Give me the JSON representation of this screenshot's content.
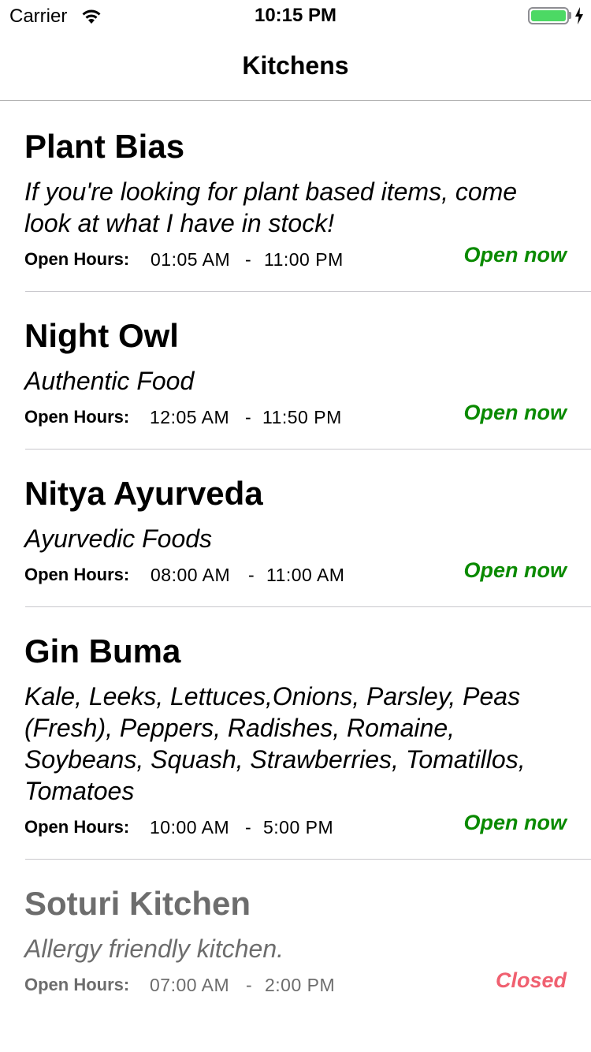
{
  "status_bar": {
    "carrier": "Carrier",
    "time": "10:15 PM",
    "battery_color": "#4cd964"
  },
  "nav": {
    "title": "Kitchens"
  },
  "kitchens": [
    {
      "name": "Plant Bias",
      "description": "If you're looking for plant based items, come look at what I have in stock!",
      "hours_label": "Open Hours:",
      "open_time": "01:05 AM",
      "dash": "-",
      "close_time": "11:00 PM",
      "status": "Open now"
    },
    {
      "name": "Night Owl",
      "description": "Authentic Food",
      "hours_label": "Open Hours:",
      "open_time": "12:05 AM",
      "dash": "-",
      "close_time": "11:50 PM",
      "status": "Open now"
    },
    {
      "name": "Nitya Ayurveda",
      "description": "Ayurvedic Foods",
      "hours_label": "Open Hours:",
      "open_time": "08:00 AM",
      "dash": "-",
      "close_time": "11:00 AM",
      "status": "Open now"
    },
    {
      "name": "Gin Buma",
      "description": "Kale, Leeks, Lettuces,Onions, Parsley, Peas (Fresh), Peppers, Radishes, Romaine, Soybeans, Squash, Strawberries, Tomatillos, Tomatoes",
      "hours_label": "Open Hours:",
      "open_time": "10:00 AM",
      "dash": "-",
      "close_time": "5:00 PM",
      "status": "Open now"
    },
    {
      "name": "Soturi Kitchen",
      "description": "Allergy friendly kitchen.",
      "hours_label": "Open Hours:",
      "open_time": "07:00 AM",
      "dash": "-",
      "close_time": "2:00 PM",
      "status": "Closed"
    }
  ],
  "colors": {
    "open": "#0a8a00",
    "closed": "#f06070",
    "dimmed_text": "#6d6d6d"
  }
}
